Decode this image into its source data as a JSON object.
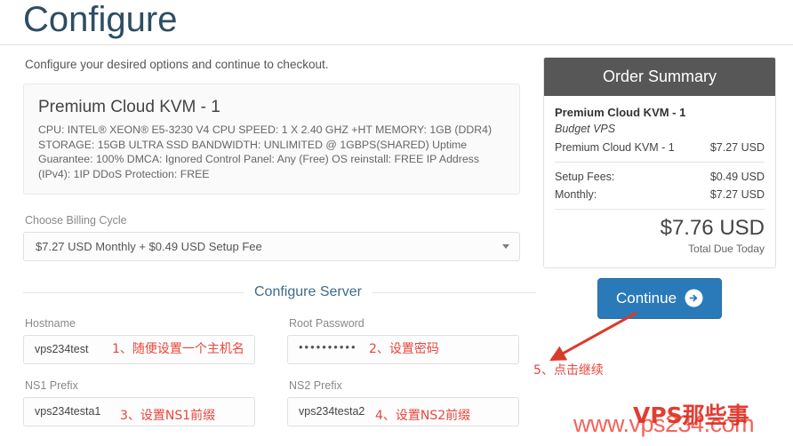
{
  "header": {
    "title": "Configure",
    "intro": "Configure your desired options and continue to checkout."
  },
  "product": {
    "name": "Premium Cloud KVM - 1",
    "description": "CPU: INTEL® XEON® E5-3230 V4 CPU SPEED: 1 X 2.40 GHZ +HT MEMORY: 1GB (DDR4) STORAGE: 15GB ULTRA SSD BANDWIDTH: UNLIMITED @ 1GBPS(SHARED) Uptime Guarantee: 100% DMCA: Ignored Control Panel: Any (Free) OS reinstall: FREE IP Address (IPv4): 1IP DDoS Protection: FREE"
  },
  "billing": {
    "label": "Choose Billing Cycle",
    "selected": "$7.27 USD Monthly + $0.49 USD Setup Fee"
  },
  "configure_server": {
    "section_title": "Configure Server",
    "fields": [
      {
        "label": "Hostname",
        "value": "vps234test",
        "type": "text"
      },
      {
        "label": "Root Password",
        "value": "••••••••••",
        "type": "password"
      },
      {
        "label": "NS1 Prefix",
        "value": "vps234testa1",
        "type": "text"
      },
      {
        "label": "NS2 Prefix",
        "value": "vps234testa2",
        "type": "text"
      }
    ]
  },
  "annotations": {
    "color": "#e8453c",
    "items": [
      {
        "id": "hostname-note",
        "text": "1、随便设置一个主机名"
      },
      {
        "id": "password-note",
        "text": "2、设置密码"
      },
      {
        "id": "ns1-note",
        "text": "3、设置NS1前缀"
      },
      {
        "id": "ns2-note",
        "text": "4、设置NS2前缀"
      },
      {
        "id": "continue-note",
        "text": "5、点击继续"
      }
    ]
  },
  "order_summary": {
    "title": "Order Summary",
    "product_name": "Premium Cloud KVM - 1",
    "product_group": "Budget VPS",
    "line_items": [
      {
        "label": "Premium Cloud KVM - 1",
        "amount": "$7.27 USD"
      }
    ],
    "fee_items": [
      {
        "label": "Setup Fees:",
        "amount": "$0.49 USD"
      },
      {
        "label": "Monthly:",
        "amount": "$7.27 USD"
      }
    ],
    "total": "$7.76 USD",
    "total_label": "Total Due Today",
    "header_bg": "#575757"
  },
  "continue": {
    "label": "Continue",
    "icon": "arrow-circle-right-icon",
    "color": "#2a7ab9"
  },
  "watermark": {
    "url": "www.vps234.com",
    "brand": "VPS那些事",
    "color": "#f04a3f"
  }
}
